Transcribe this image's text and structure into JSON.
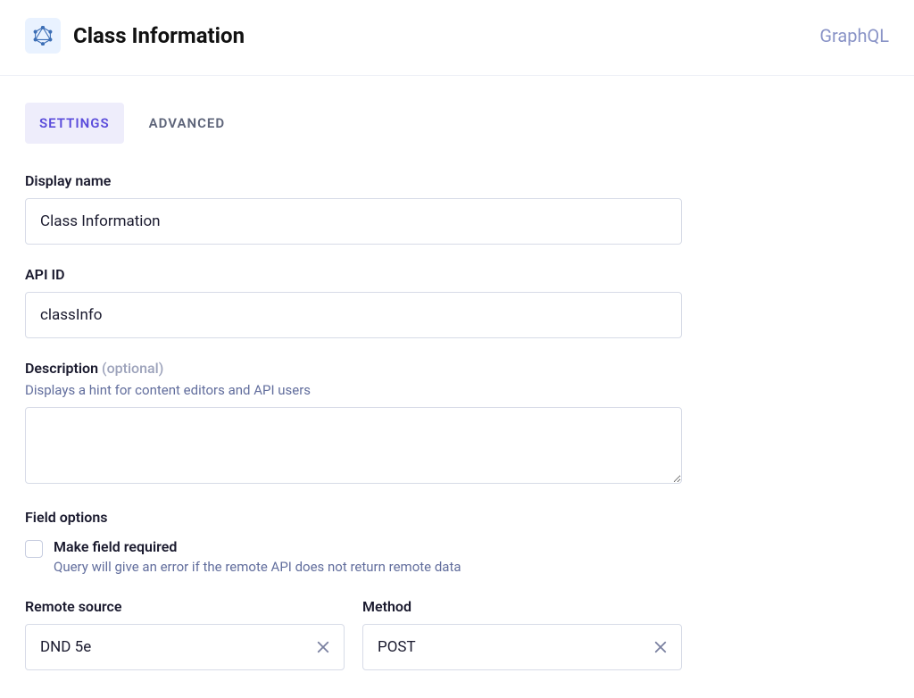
{
  "header": {
    "title": "Class Information",
    "right_label": "GraphQL",
    "icon": "graphql-icon"
  },
  "tabs": [
    {
      "label": "Settings",
      "active": true
    },
    {
      "label": "Advanced",
      "active": false
    }
  ],
  "form": {
    "display_name": {
      "label": "Display name",
      "value": "Class Information"
    },
    "api_id": {
      "label": "API ID",
      "value": "classInfo"
    },
    "description": {
      "label": "Description",
      "optional_tag": "(optional)",
      "hint": "Displays a hint for content editors and API users",
      "value": ""
    },
    "field_options": {
      "title": "Field options",
      "required": {
        "label": "Make field required",
        "hint": "Query will give an error if the remote API does not return remote data",
        "checked": false
      }
    },
    "remote_source": {
      "label": "Remote source",
      "value": "DND 5e"
    },
    "method": {
      "label": "Method",
      "value": "POST"
    }
  }
}
